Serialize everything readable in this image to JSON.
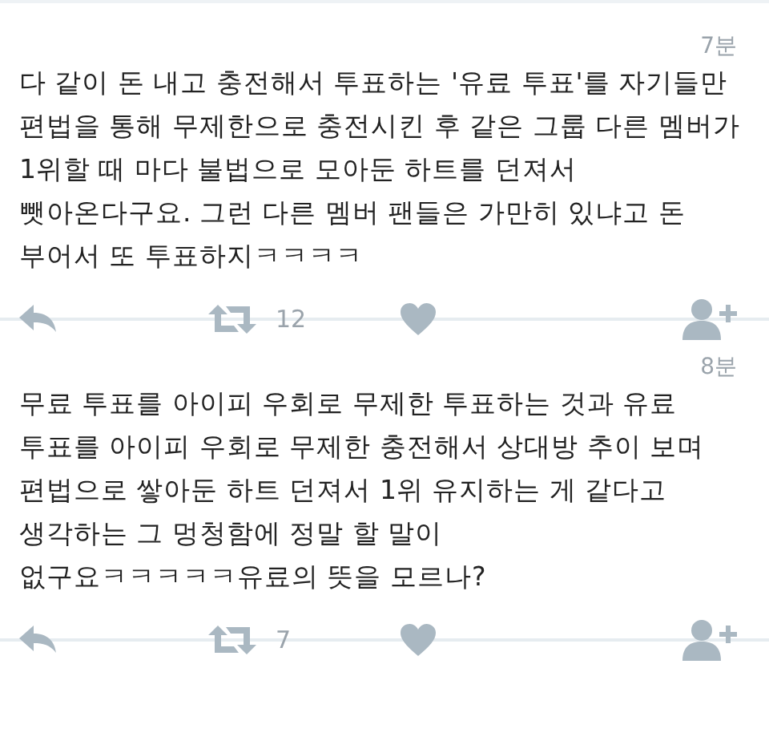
{
  "tweets": [
    {
      "time": "7분",
      "lines": [
        "다 같이 돈 내고 충전해서 투표하는 '유료 투표'를 자기들만",
        "편법을 통해 무제한으로 충전시킨 후 같은 그룹 다른 멤버가",
        "1위할 때 마다 불법으로 모아둔 하트를 던져서",
        "뺏아온다구요. 그런 다른 멤버 팬들은 가만히 있냐고 돈",
        "부어서 또 투표하지ㅋㅋㅋㅋ"
      ],
      "retweet_count": "12"
    },
    {
      "time": "8분",
      "lines": [
        "무료 투표를 아이피 우회로 무제한 투표하는 것과 유료",
        "투표를 아이피 우회로 무제한 충전해서 상대방 추이 보며",
        "편법으로 쌓아둔 하트 던져서 1위 유지하는 게 같다고",
        "생각하는 그 멍청함에 정말 할 말이",
        "없구요ㅋㅋㅋㅋㅋ유료의 뜻을 모르나?"
      ],
      "retweet_count": "7"
    }
  ]
}
